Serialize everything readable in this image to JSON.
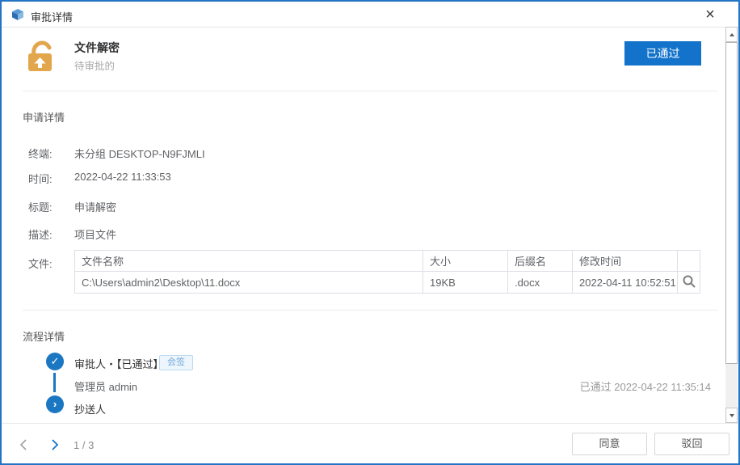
{
  "window": {
    "title": "审批详情"
  },
  "icons": {
    "app": "blue-cube",
    "close": "×",
    "lock": "unlocked-padlock",
    "approved_check": "✓",
    "forward_chevron": "›",
    "search": "magnifier",
    "prev_chevron": "‹",
    "next_chevron": "›",
    "scroll_up": "triangle-up",
    "scroll_down": "triangle-down"
  },
  "colors": {
    "accent_blue": "#1373cb",
    "window_border": "#2374c5",
    "lock_orange": "#e2a64d",
    "tag_blue": "#6ea7d8",
    "text_dark": "#303133",
    "text_gray": "#606266",
    "text_muted": "#9a9a9a"
  },
  "header": {
    "title": "文件解密",
    "subtitle": "待审批的",
    "status_badge": "已通过"
  },
  "request": {
    "section_title": "申请详情",
    "fields": [
      {
        "label": "终端:",
        "value": "未分组 DESKTOP-N9FJMLI"
      },
      {
        "label": "时间:",
        "value": "2022-04-22 11:33:53"
      },
      {
        "label": "标题:",
        "value": "申请解密"
      },
      {
        "label": "描述:",
        "value": "项目文件"
      }
    ],
    "files_label": "文件:",
    "files_table": {
      "headers": [
        "文件名称",
        "大小",
        "后缀名",
        "修改时间"
      ],
      "rows": [
        {
          "name": "C:\\Users\\admin2\\Desktop\\11.docx",
          "size": "19KB",
          "ext": ".docx",
          "modified": "2022-04-11 10:52:51"
        }
      ]
    }
  },
  "process": {
    "section_title": "流程详情",
    "steps": [
      {
        "title": "审批人・【已通过】",
        "tag": "会签",
        "assignee": "管理员 admin",
        "result": "已通过 2022-04-22 11:35:14"
      },
      {
        "title": "抄送人"
      }
    ]
  },
  "footer": {
    "page_indicator": "1 / 3",
    "agree_button": "同意",
    "reject_button": "驳回"
  }
}
